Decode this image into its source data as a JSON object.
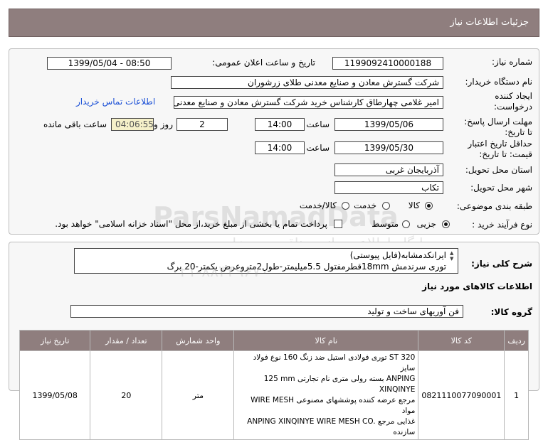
{
  "header": {
    "title": "جزئیات اطلاعات نیاز"
  },
  "form": {
    "need_number_label": "شماره نیاز:",
    "need_number": "1199092410000188",
    "announce_label": "تاریخ و ساعت اعلان عمومی:",
    "announce_value": "1399/05/04 - 08:50",
    "buyer_label": "نام دستگاه خریدار:",
    "buyer_value": "شرکت گسترش معادن و صنایع معدنی طلای زرشوران",
    "creator_label_1": "ایجاد کننده",
    "creator_label_2": "درخواست:",
    "creator_value": "امیر غلامی چهارطاق کارشناس خرید شرکت گسترش معادن و صنایع معدنی ط",
    "contact_link": "اطلاعات تماس خریدار",
    "reply_label_1": "مهلت ارسال پاسخ:",
    "reply_label_2": "تا تاریخ:",
    "reply_date": "1399/05/06",
    "time_label": "ساعت",
    "reply_time": "14:00",
    "days_value": "2",
    "days_label": "روز و",
    "remaining_time": "04:06:55",
    "remaining_label": "ساعت باقی مانده",
    "validity_label_1": "حداقل تاریخ اعتبار",
    "validity_label_2": "قیمت: تا تاریخ:",
    "validity_date": "1399/05/30",
    "validity_time": "14:00",
    "province_label": "استان محل تحویل:",
    "province_value": "آذربایجان غربی",
    "city_label": "شهر محل تحویل:",
    "city_value": "تکاب",
    "category_label": "طبقه بندی موضوعی:",
    "category_options": [
      "کالا",
      "خدمت",
      "کالا/خدمت"
    ],
    "process_label": "نوع فرآیند خرید :",
    "process_options": [
      "جزیی",
      "متوسط"
    ],
    "payment_text": "پرداخت تمام یا بخشی از مبلغ خرید،از محل \"اسناد خزانه اسلامی\" خواهد بود."
  },
  "watermark": {
    "brand": "ParsNamadData",
    "subtitle": "پایگاه اطلاع رسانی مناقصه و مزایده",
    "phone": "۰۲۱-۸۸۳۴۹۶۷۰"
  },
  "summary": {
    "label": "شرح کلی نیاز:",
    "line1": "ایرانکدمشابه(فایل پیوستی)",
    "line2": "توری سرندمش 18mmقطرمفتول 5.5میلیمتر-طول2متروعرض یکمتر-20 برگ"
  },
  "goods": {
    "section_title": "اطلاعات کالاهای مورد نیاز",
    "group_label": "گروه کالا:",
    "group_value": "فن آوریهای ساخت و تولید",
    "columns": [
      "ردیف",
      "کد کالا",
      "نام کالا",
      "واحد شمارش",
      "تعداد / مقدار",
      "تاریخ نیاز"
    ],
    "rows": [
      {
        "row": "1",
        "code": "0821110077090001",
        "name_lines": [
          "توری فولادی استیل ضد زنگ 160 نوع فولاد ST 320 سایز",
          "125 mm بسته رولی متری نام تجارتی ANPING XINQINYE",
          "WIRE MESH مرجع عرضه کننده پوششهای مصنوعی مواد",
          "ANPING XINQINYE WIRE MESH CO. غذایی مرجع سازنده"
        ],
        "unit": "متر",
        "qty": "20",
        "date": "1399/05/08"
      }
    ]
  }
}
